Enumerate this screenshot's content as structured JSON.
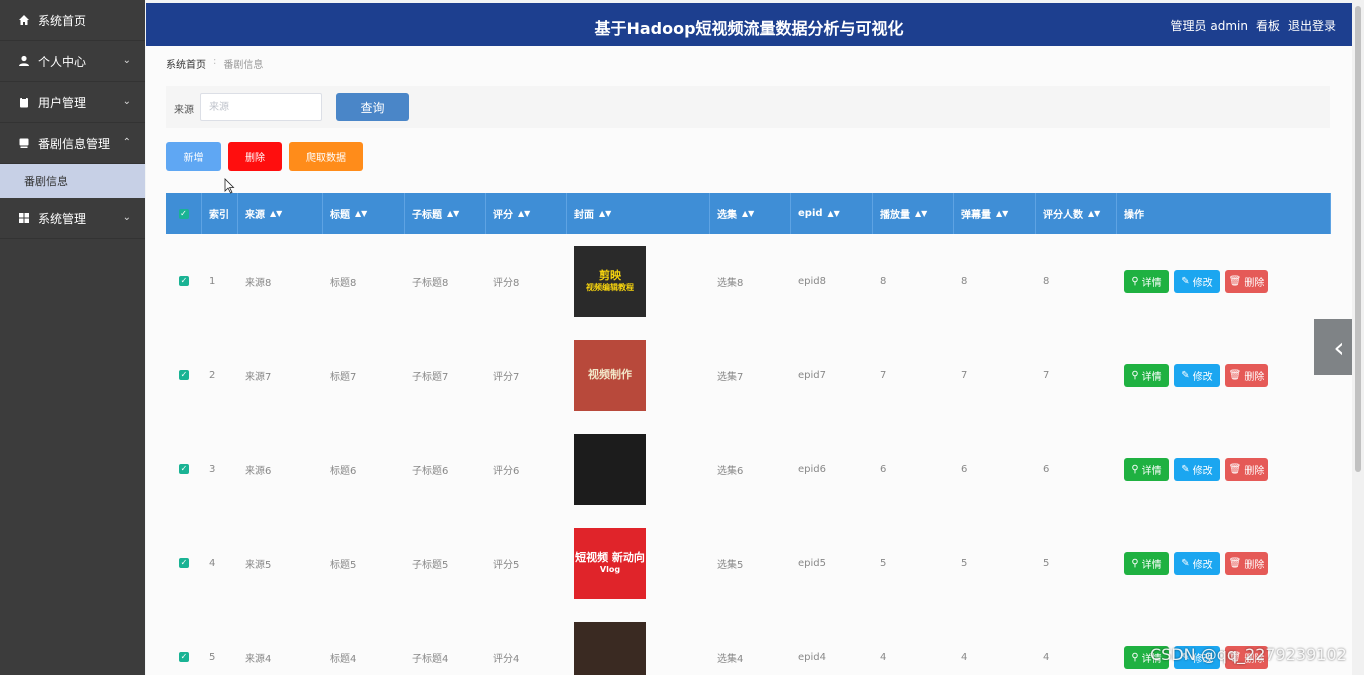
{
  "app": {
    "title": "基于Hadoop短视频流量数据分析与可视化",
    "user_label": "管理员 admin",
    "board_link": "看板",
    "logout_link": "退出登录"
  },
  "sidebar": {
    "items": [
      {
        "label": "系统首页",
        "icon": "home-icon"
      },
      {
        "label": "个人中心",
        "icon": "user-icon",
        "expandable": true
      },
      {
        "label": "用户管理",
        "icon": "clipboard-icon",
        "expandable": true
      },
      {
        "label": "番剧信息管理",
        "icon": "tablet-icon",
        "expandable": true,
        "expanded": true
      },
      {
        "label": "系统管理",
        "icon": "grid-icon",
        "expandable": true
      }
    ],
    "sub_item": "番剧信息"
  },
  "breadcrumb": {
    "home": "系统首页",
    "current": "番剧信息"
  },
  "search": {
    "label": "来源",
    "placeholder": "来源",
    "value": "",
    "button": "查询"
  },
  "actions": {
    "add": "新增",
    "delete": "删除",
    "crawl": "爬取数据"
  },
  "table": {
    "headers": [
      "索引",
      "来源",
      "标题",
      "子标题",
      "评分",
      "封面",
      "选集",
      "epid",
      "播放量",
      "弹幕量",
      "评分人数",
      "操作"
    ],
    "row_buttons": {
      "detail": "详情",
      "edit": "修改",
      "remove": "删除"
    },
    "rows": [
      {
        "index": "1",
        "source": "来源8",
        "title": "标题8",
        "subtitle": "子标题8",
        "score": "评分8",
        "episode": "选集8",
        "epid": "epid8",
        "plays": "8",
        "danmaku": "8",
        "raters": "8",
        "cover": {
          "text": "剪映",
          "sub": "视频编辑教程",
          "bg": "#2a2a2a",
          "accent": "#f5d20e"
        }
      },
      {
        "index": "2",
        "source": "来源7",
        "title": "标题7",
        "subtitle": "子标题7",
        "score": "评分7",
        "episode": "选集7",
        "epid": "epid7",
        "plays": "7",
        "danmaku": "7",
        "raters": "7",
        "cover": {
          "text": "视频制作",
          "sub": "",
          "bg": "#b8493b",
          "accent": "#f2e6c8"
        }
      },
      {
        "index": "3",
        "source": "来源6",
        "title": "标题6",
        "subtitle": "子标题6",
        "score": "评分6",
        "episode": "选集6",
        "epid": "epid6",
        "plays": "6",
        "danmaku": "6",
        "raters": "6",
        "cover": {
          "text": "",
          "sub": "",
          "bg": "#1c1c1c",
          "accent": "#8a5a3a"
        }
      },
      {
        "index": "4",
        "source": "来源5",
        "title": "标题5",
        "subtitle": "子标题5",
        "score": "评分5",
        "episode": "选集5",
        "epid": "epid5",
        "plays": "5",
        "danmaku": "5",
        "raters": "5",
        "cover": {
          "text": "短视频 新动向",
          "sub": "Vlog",
          "bg": "#e0242a",
          "accent": "#ffffff"
        }
      },
      {
        "index": "5",
        "source": "来源4",
        "title": "标题4",
        "subtitle": "子标题4",
        "score": "评分4",
        "episode": "选集4",
        "epid": "epid4",
        "plays": "4",
        "danmaku": "4",
        "raters": "4",
        "cover": {
          "text": "",
          "sub": "",
          "bg": "#3a2a22",
          "accent": "#c8a070"
        }
      }
    ]
  },
  "watermark": "CSDN @qq_2279239102",
  "colors": {
    "sidebar": "#3c3c3c",
    "header": "#1d3f8f",
    "table_header": "#3f8ed6",
    "detail": "#1fb141",
    "edit": "#1ba6f0",
    "remove": "#e55a57"
  }
}
